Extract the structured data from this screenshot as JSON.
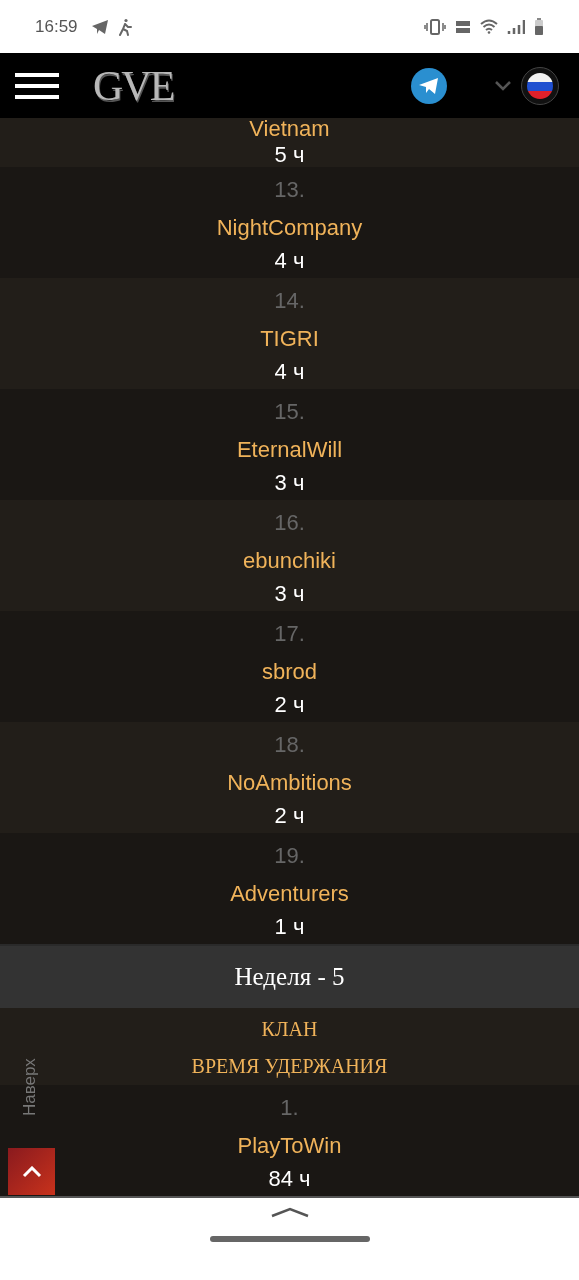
{
  "status_bar": {
    "time": "16:59"
  },
  "header": {
    "logo": "GVE"
  },
  "ranking": {
    "rows": [
      {
        "clan": "Vietnam",
        "time": "5 ч"
      },
      {
        "rank": "13.",
        "clan": "NightCompany",
        "time": "4 ч"
      },
      {
        "rank": "14.",
        "clan": "TIGRI",
        "time": "4 ч"
      },
      {
        "rank": "15.",
        "clan": "EternalWill",
        "time": "3 ч"
      },
      {
        "rank": "16.",
        "clan": "ebunchiki",
        "time": "3 ч"
      },
      {
        "rank": "17.",
        "clan": "sbrod",
        "time": "2 ч"
      },
      {
        "rank": "18.",
        "clan": "NoAmbitions",
        "time": "2 ч"
      },
      {
        "rank": "19.",
        "clan": "Adventurers",
        "time": "1 ч"
      }
    ]
  },
  "week": {
    "title": "Неделя - 5",
    "columns": [
      "КЛАН",
      "ВРЕМЯ УДЕРЖАНИЯ"
    ],
    "rows": [
      {
        "rank": "1.",
        "clan": "PlayToWin",
        "time": "84 ч"
      }
    ]
  },
  "back_to_top": {
    "label": "Наверх"
  }
}
